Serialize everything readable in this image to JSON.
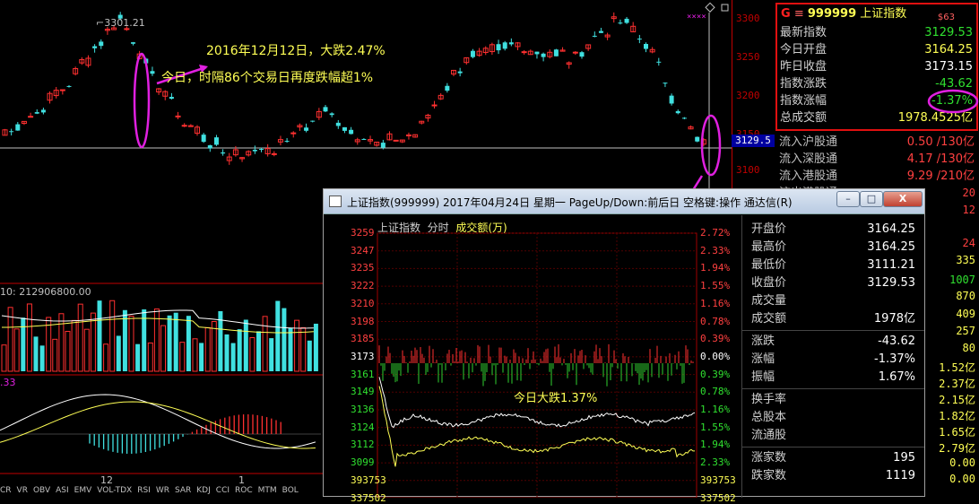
{
  "main_chart": {
    "high_label": "3301.21",
    "axis_ticks": [
      "3300",
      "3250",
      "3200",
      "3150",
      "3100"
    ],
    "current_price": "3129.5",
    "annotation_line1": "2016年12月12日，大跌2.47%",
    "annotation_line2": "今日，时隔86个交易日再度跌幅超1%",
    "volume_label": "10: 212906800.00",
    "macd_label": ".33",
    "bottom_tabs": [
      "CR",
      "VR",
      "OBV",
      "ASI",
      "EMV",
      "VOL-TDX",
      "RSI",
      "WR",
      "SAR",
      "KDJ",
      "CCI",
      "ROC",
      "MTM",
      "BOL"
    ],
    "date_marker_12": "12",
    "date_marker_1": "1"
  },
  "quote_panel": {
    "logo": "G",
    "menu_icon": "≡",
    "code": "999999",
    "name": "上证指数",
    "tag": "$63",
    "rows": [
      {
        "label": "最新指数",
        "value": "3129.53",
        "color": "green"
      },
      {
        "label": "今日开盘",
        "value": "3164.25",
        "color": "yellow"
      },
      {
        "label": "昨日收盘",
        "value": "3173.15",
        "color": "white"
      },
      {
        "label": "指数涨跌",
        "value": "-43.62",
        "color": "green"
      },
      {
        "label": "指数涨幅",
        "value": "-1.37%",
        "color": "green"
      },
      {
        "label": "总成交额",
        "value": "1978.4525亿",
        "color": "yellow"
      }
    ]
  },
  "flows": [
    {
      "label": "流入沪股通",
      "value": "0.50 /130亿"
    },
    {
      "label": "流入深股通",
      "value": "4.17 /130亿"
    },
    {
      "label": "流入港股通",
      "value": "9.29 /210亿"
    },
    {
      "label": "流出港股通",
      "value": ""
    }
  ],
  "side_numbers": [
    {
      "value": "20",
      "color": "red"
    },
    {
      "value": "12",
      "color": "red"
    },
    {
      "value": "24",
      "color": "red"
    },
    {
      "value": "335",
      "color": "yellow"
    },
    {
      "value": "1007",
      "color": "green"
    },
    {
      "value": "870",
      "color": "yellow"
    },
    {
      "value": "409",
      "color": "yellow"
    },
    {
      "value": "257",
      "color": "yellow"
    },
    {
      "value": "80",
      "color": "yellow"
    },
    {
      "value": "1.52亿",
      "color": "yellow"
    },
    {
      "value": "2.37亿",
      "color": "yellow"
    },
    {
      "value": "2.15亿",
      "color": "yellow"
    },
    {
      "value": "1.82亿",
      "color": "yellow"
    },
    {
      "value": "1.65亿",
      "color": "yellow"
    },
    {
      "value": "2.79亿",
      "color": "yellow"
    },
    {
      "value": "0.00",
      "color": "yellow"
    },
    {
      "value": "0.00",
      "color": "yellow"
    }
  ],
  "popup": {
    "title": "上证指数(999999) 2017年04月24日 星期一 PageUp/Down:前后日 空格键:操作 通达信(R)",
    "btn_min": "–",
    "btn_max": "□",
    "btn_close": "X",
    "chart_title": "上证指数",
    "chart_mode": "分时",
    "chart_sub": "成交额(万)",
    "left_ticks": [
      "3259",
      "3247",
      "3235",
      "3222",
      "3210",
      "3198",
      "3185",
      "3173",
      "3161",
      "3149",
      "3136",
      "3124",
      "3112",
      "3099",
      "393753",
      "337502"
    ],
    "right_ticks": [
      "2.72%",
      "2.33%",
      "1.94%",
      "1.55%",
      "1.16%",
      "0.78%",
      "0.39%",
      "0.00%",
      "0.39%",
      "0.78%",
      "1.16%",
      "1.55%",
      "1.94%",
      "2.33%",
      "393753",
      "337502"
    ],
    "annotation": "今日大跌1.37%",
    "info_rows": [
      {
        "label": "开盘价",
        "value": "3164.25"
      },
      {
        "label": "最高价",
        "value": "3164.25"
      },
      {
        "label": "最低价",
        "value": "3111.21"
      },
      {
        "label": "收盘价",
        "value": "3129.53"
      },
      {
        "label": "成交量",
        "value": ""
      },
      {
        "label": "成交额",
        "value": "1978亿"
      }
    ],
    "info_rows2": [
      {
        "label": "涨跌",
        "value": "-43.62"
      },
      {
        "label": "涨幅",
        "value": "-1.37%"
      },
      {
        "label": "振幅",
        "value": "1.67%"
      }
    ],
    "info_rows3": [
      {
        "label": "换手率",
        "value": ""
      },
      {
        "label": "总股本",
        "value": ""
      },
      {
        "label": "流通股",
        "value": ""
      }
    ],
    "info_rows4": [
      {
        "label": "涨家数",
        "value": "195"
      },
      {
        "label": "跌家数",
        "value": "1119"
      }
    ]
  },
  "colors": {
    "up": "#ff3030",
    "down": "#40e0e0",
    "highlight": "#e020e0",
    "accent_yellow": "#ffff55"
  }
}
